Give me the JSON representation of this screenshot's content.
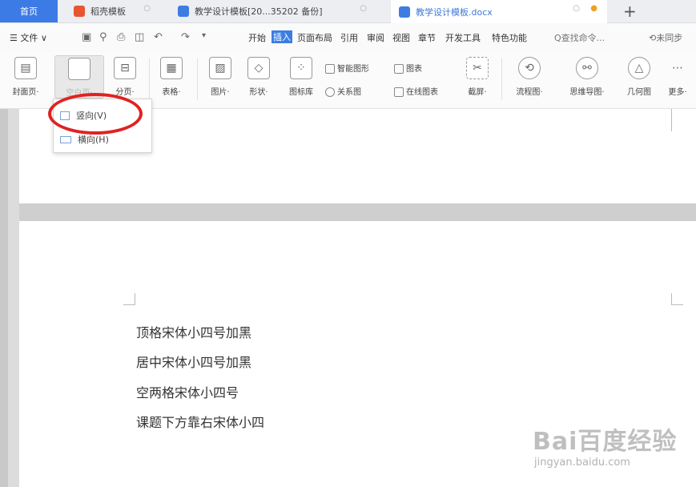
{
  "tabs": {
    "home": "首页",
    "t1": "稻壳模板",
    "t2": "教学设计模板[20...35202 备份]",
    "t3": "教学设计模板.docx",
    "new": "+"
  },
  "menu": {
    "file": "☰ 文件 ∨",
    "items": [
      "开始",
      "插入",
      "页面布局",
      "引用",
      "审阅",
      "视图",
      "章节",
      "开发工具",
      "特色功能"
    ],
    "search": "Q查找命令...",
    "collab": "⟲未同步"
  },
  "ribbon": {
    "cover": "封面页·",
    "blank": "空白页·",
    "pagebreak": "分页·",
    "table": "表格·",
    "picture": "图片·",
    "shape": "形状·",
    "iconlib": "图标库",
    "smartart": "智能图形",
    "chart": "图表",
    "relation": "关系图",
    "onlinechart": "在线图表",
    "screenshot": "截屏·",
    "flowchart": "流程图·",
    "mindmap": "思维导图·",
    "geometry": "几何图",
    "more": "更多·"
  },
  "dropdown": {
    "portrait": "竖向(V)",
    "landscape": "横向(H)"
  },
  "document": {
    "lines": [
      "顶格宋体小四号加黑",
      "居中宋体小四号加黑",
      "空两格宋体小四号",
      "课题下方靠右宋体小四"
    ]
  },
  "watermark": {
    "logo": "Bai百度经验",
    "url": "jingyan.baidu.com"
  },
  "colors": {
    "accent": "#3c7be6",
    "highlight_circle": "#e02222"
  }
}
